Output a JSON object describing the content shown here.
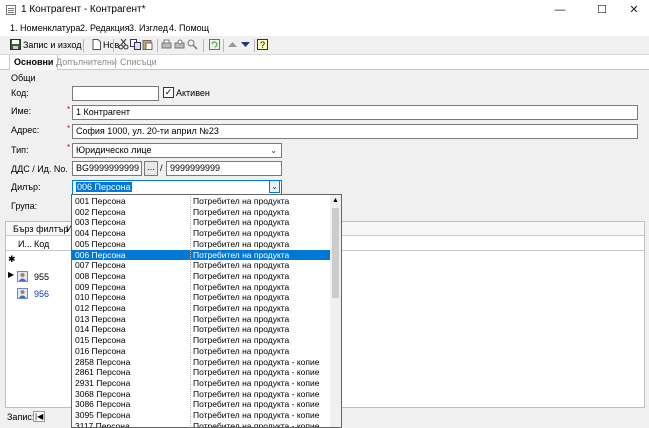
{
  "window": {
    "title": "1 Контрагент - Контрагент*",
    "minimize": "—",
    "maximize": "☐",
    "close": "✕"
  },
  "menu": [
    "1. Номенклатура",
    "2. Редакция",
    "3. Изглед",
    "4. Помощ"
  ],
  "toolbar": {
    "save_close": "Запис и изход",
    "new": "Нов"
  },
  "tabs": [
    "Основни",
    "Допълнителни",
    "Списъци"
  ],
  "form": {
    "section": "Общи",
    "code_label": "Код:",
    "code_value": "",
    "active_label": "Активен",
    "active_checked": "✓",
    "name_label": "Име:",
    "name_value": "1 Контрагент",
    "address_label": "Адрес:",
    "address_value": "София 1000, ул. 20-ти април №23",
    "type_label": "Тип:",
    "type_value": "Юридическо лице",
    "vat_label": "ДДС / Ид. No.",
    "vat_value": "BG9999999999",
    "vat_dots": "...",
    "vat_slash": "/",
    "id_value": "9999999999",
    "dealer_label": "Дилър:",
    "dealer_value": "006 Персона",
    "group_label": "Група:"
  },
  "filter": {
    "label": "Бърз филтър",
    "prefix": "И"
  },
  "grid": {
    "col1": "И...",
    "col2": "Код",
    "new_row": "✱",
    "rows": [
      {
        "code": "955"
      },
      {
        "code": "956"
      }
    ]
  },
  "status": {
    "record_label": "Запис:",
    "first": "|◀"
  },
  "dropdown": {
    "selected_index": 5,
    "items": [
      {
        "code": "001 Персона",
        "desc": "Потребител на продукта"
      },
      {
        "code": "002 Персона",
        "desc": "Потребител на продукта"
      },
      {
        "code": "003 Персона",
        "desc": "Потребител на продукта"
      },
      {
        "code": "004 Персона",
        "desc": "Потребител на продукта"
      },
      {
        "code": "005 Персона",
        "desc": "Потребител на продукта"
      },
      {
        "code": "006 Персона",
        "desc": "Потребител на продукта"
      },
      {
        "code": "007 Персона",
        "desc": "Потребител на продукта"
      },
      {
        "code": "008 Персона",
        "desc": "Потребител на продукта"
      },
      {
        "code": "009 Персона",
        "desc": "Потребител на продукта"
      },
      {
        "code": "010 Персона",
        "desc": "Потребител на продукта"
      },
      {
        "code": "012 Персона",
        "desc": "Потребител на продукта"
      },
      {
        "code": "013 Персона",
        "desc": "Потребител на продукта"
      },
      {
        "code": "014 Персона",
        "desc": "Потребител на продукта"
      },
      {
        "code": "015 Персона",
        "desc": "Потребител на продукта"
      },
      {
        "code": "016 Персона",
        "desc": "Потребител на продукта"
      },
      {
        "code": "2858 Персона",
        "desc": "Потребител на продукта - копие"
      },
      {
        "code": "2861 Персона",
        "desc": "Потребител на продукта - копие"
      },
      {
        "code": "2931 Персона",
        "desc": "Потребител на продукта - копие"
      },
      {
        "code": "3068 Персона",
        "desc": "Потребител на продукта - копие"
      },
      {
        "code": "3086 Персона",
        "desc": "Потребител на продукта - копие"
      },
      {
        "code": "3095 Персона",
        "desc": "Потребител на продукта - копие"
      },
      {
        "code": "3117 Персона",
        "desc": "Потребител на продукта - копие"
      }
    ]
  },
  "colors": {
    "selection": "#0078d7",
    "required": "#dd0000",
    "link_blue": "#0040c0"
  }
}
